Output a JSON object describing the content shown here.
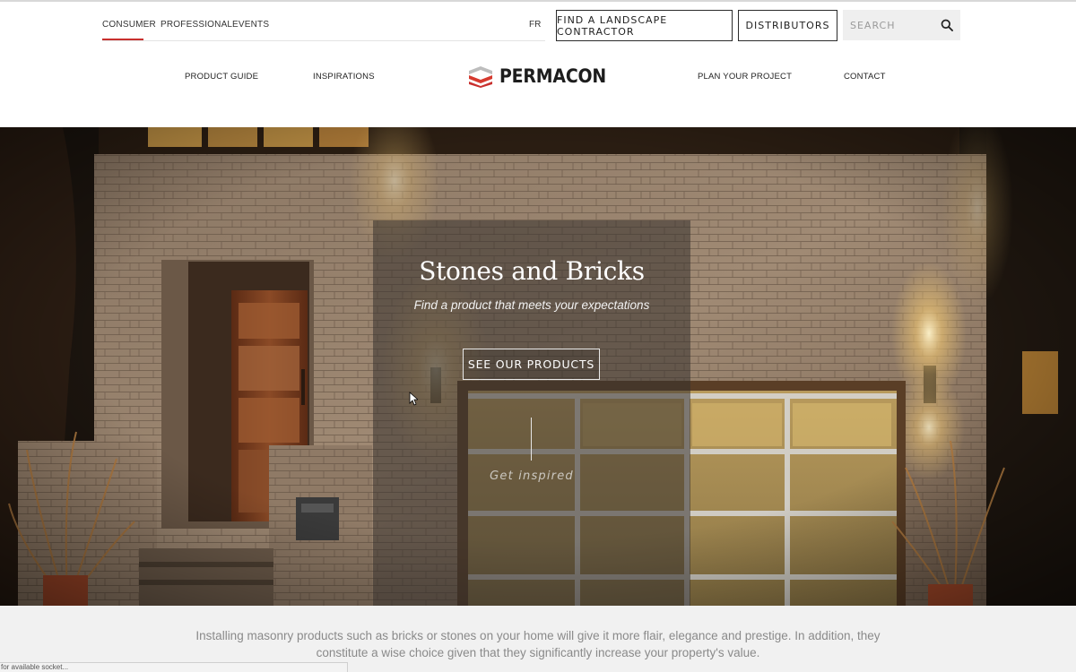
{
  "audience_tabs": [
    {
      "label": "CONSUMER",
      "active": true
    },
    {
      "label": "PROFESSIONAL",
      "active": false
    },
    {
      "label": "EVENTS",
      "active": false
    }
  ],
  "language_toggle": "FR",
  "header_buttons": {
    "find_contractor": "FIND A LANDSCAPE CONTRACTOR",
    "distributors": "DISTRIBUTORS"
  },
  "search": {
    "placeholder": "SEARCH",
    "value": ""
  },
  "main_nav": {
    "product_guide": "PRODUCT GUIDE",
    "inspirations": "INSPIRATIONS",
    "plan_project": "PLAN YOUR PROJECT",
    "contact": "CONTACT"
  },
  "logo": {
    "text": "PERMACON"
  },
  "hero": {
    "title": "Stones and Bricks",
    "subtitle": "Find a product that meets your expectations",
    "cta_label": "SEE OUR PRODUCTS",
    "get_inspired": "Get inspired"
  },
  "intro": {
    "text": "Installing masonry products such as bricks or stones on your home will give it more flair, elegance and prestige. In addition, they constitute a wise choice given that they significantly increase your property's value."
  },
  "browser_status": "for available socket...",
  "colors": {
    "accent": "#c8302e",
    "overlay": "#37322e",
    "intro_bg": "#f1f1f1"
  }
}
